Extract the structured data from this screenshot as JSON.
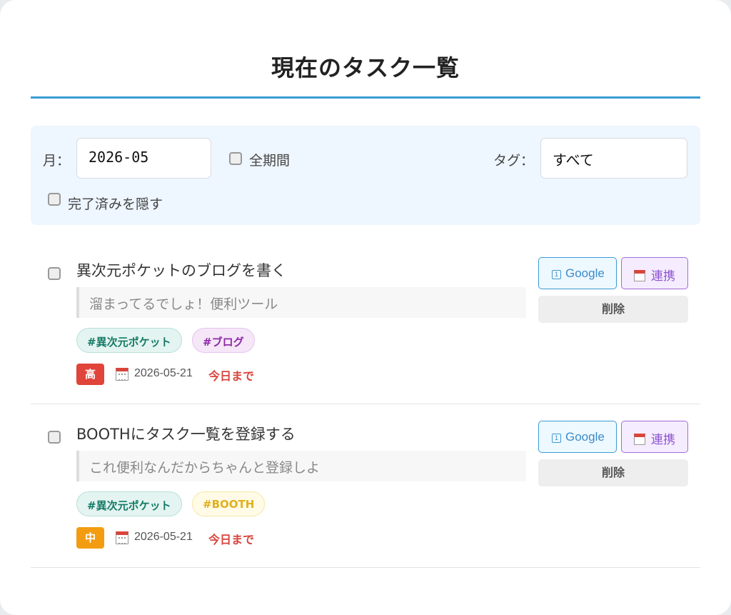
{
  "page": {
    "title": "現在のタスク一覧"
  },
  "filters": {
    "month_label": "月：",
    "month_value": "2026-05",
    "all_period_label": "全期間",
    "tag_label": "タグ：",
    "tag_value": "すべて",
    "hide_completed_label": "完了済みを隠す"
  },
  "tasks": [
    {
      "title": "異次元ポケットのブログを書く",
      "description": "溜まってるでしょ！便利ツール",
      "tags": [
        {
          "label": "#異次元ポケット",
          "color": "#147a66"
        },
        {
          "label": "#ブログ",
          "color": "#8e2aa6"
        }
      ],
      "priority": "高",
      "priority_color": "#e0443a",
      "due_date": "2026-05-21",
      "due_note": "今日まで",
      "google_label": "Google",
      "link_label": "連携",
      "delete_label": "削除"
    },
    {
      "title": "BOOTHにタスク一覧を登録する",
      "description": "これ便利なんだからちゃんと登録しよ",
      "tags": [
        {
          "label": "#異次元ポケット",
          "color": "#147a66"
        },
        {
          "label": "#BOOTH",
          "color": "#e0b020"
        }
      ],
      "priority": "中",
      "priority_color": "#f39c12",
      "due_date": "2026-05-21",
      "due_note": "今日まで",
      "google_label": "Google",
      "link_label": "連携",
      "delete_label": "削除"
    }
  ],
  "icons": {
    "google_calendar": "calendar-1-icon",
    "link_calendar": "calendar-icon",
    "due_calendar": "calendar-icon"
  }
}
